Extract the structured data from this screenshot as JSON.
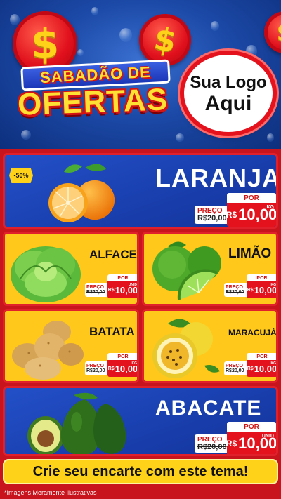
{
  "header": {
    "title_top": "SABADÃO DE",
    "title_main": "OFERTAS",
    "logo_line1": "Sua Logo",
    "logo_line2": "Aqui",
    "coin_symbol": "$"
  },
  "products": [
    {
      "name": "LARANJA",
      "badge": "-50%",
      "price_label": "PREÇO",
      "old_price": "R$20,00",
      "por": "POR",
      "new_price_prefix": "R$",
      "new_price": "10,00",
      "unit": "KG"
    },
    {
      "name": "ALFACE",
      "price_label": "PREÇO",
      "old_price": "R$20,00",
      "por": "POR",
      "new_price_prefix": "R$",
      "new_price": "10,00",
      "unit": "UNID"
    },
    {
      "name": "LIMÃO",
      "price_label": "PREÇO",
      "old_price": "R$20,00",
      "por": "POR",
      "new_price_prefix": "R$",
      "new_price": "10,00",
      "unit": "KG"
    },
    {
      "name": "BATATA",
      "price_label": "PREÇO",
      "old_price": "R$20,00",
      "por": "POR",
      "new_price_prefix": "R$",
      "new_price": "10,00",
      "unit": "KG"
    },
    {
      "name": "MARACUJÁ",
      "price_label": "PREÇO",
      "old_price": "R$20,00",
      "por": "POR",
      "new_price_prefix": "R$",
      "new_price": "10,00",
      "unit": "KG"
    },
    {
      "name": "ABACATE",
      "price_label": "PREÇO",
      "old_price": "R$20,00",
      "por": "POR",
      "new_price_prefix": "R$",
      "new_price": "10,00",
      "unit": "UNID"
    }
  ],
  "cta": "Crie seu encarte com este tema!",
  "disclaimer": "*Imagens Meramente Ilustrativas",
  "colors": {
    "red": "#e3121c",
    "yellow": "#ffc81a",
    "blue": "#1c4aa8"
  }
}
